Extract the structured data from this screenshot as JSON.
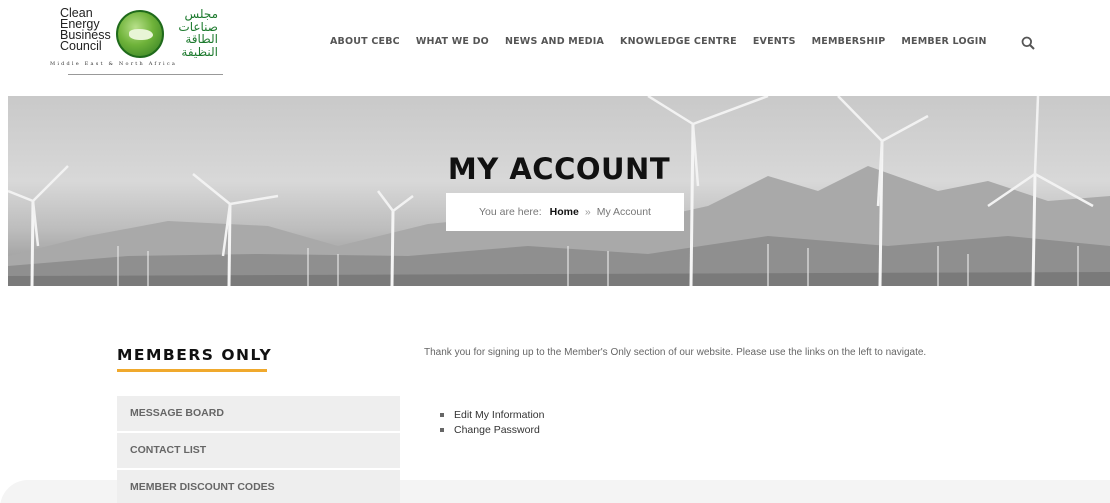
{
  "logo": {
    "name_lines": [
      "Clean",
      "Energy",
      "Business",
      "Council"
    ],
    "arabic_lines": [
      "مجلس",
      "صناعات",
      "الطاقة",
      "النظيفة"
    ],
    "tagline": "Middle East & North Africa"
  },
  "nav": {
    "items": [
      "ABOUT CEBC",
      "WHAT WE DO",
      "NEWS AND MEDIA",
      "KNOWLEDGE CENTRE",
      "EVENTS",
      "MEMBERSHIP",
      "MEMBER LOGIN"
    ],
    "search_icon": "search-icon"
  },
  "hero": {
    "title": "MY ACCOUNT",
    "breadcrumb_prefix": "You are here:",
    "breadcrumb_home": "Home",
    "breadcrumb_sep": "»",
    "breadcrumb_current": "My Account"
  },
  "sidebar": {
    "title": "MEMBERS ONLY",
    "accent_color": "#f0a92d",
    "items": [
      "MESSAGE BOARD",
      "CONTACT LIST",
      "MEMBER DISCOUNT CODES"
    ]
  },
  "main": {
    "intro": "Thank you for signing up to the Member's Only section of our website. Please use the links on the left to navigate.",
    "links": [
      "Edit My Information",
      "Change Password"
    ]
  }
}
